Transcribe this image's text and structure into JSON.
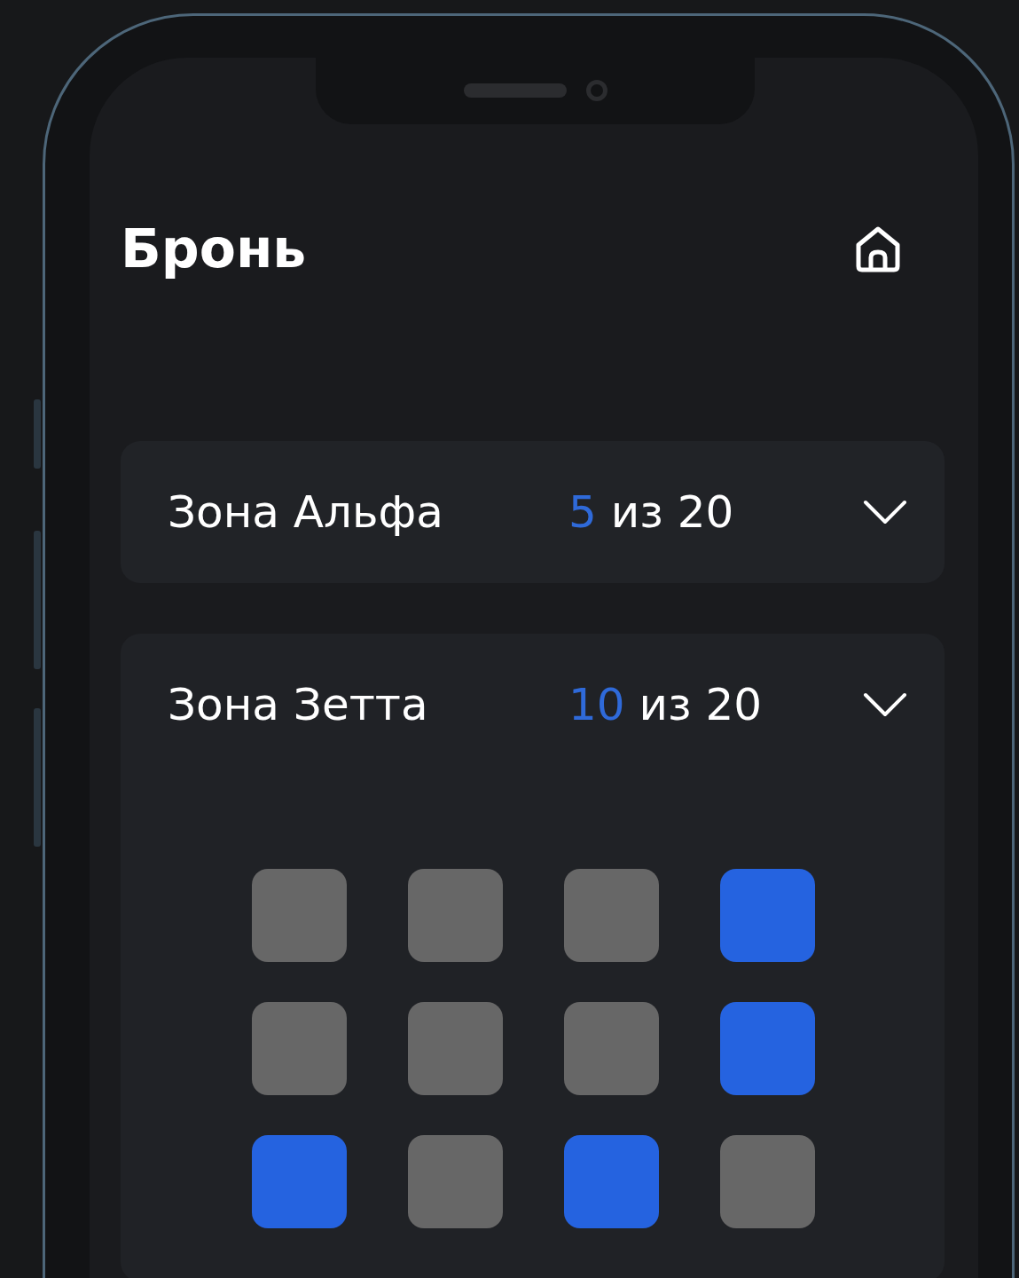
{
  "header": {
    "title": "Бронь"
  },
  "zones": [
    {
      "name": "Зона Альфа",
      "count": "5",
      "total": "из 20",
      "expanded": false
    },
    {
      "name": "Зона Зетта",
      "count": "10",
      "total": "из 20",
      "expanded": true,
      "seats": [
        {
          "selected": false
        },
        {
          "selected": false
        },
        {
          "selected": false
        },
        {
          "selected": true
        },
        {
          "selected": false
        },
        {
          "selected": false
        },
        {
          "selected": false
        },
        {
          "selected": true
        },
        {
          "selected": true
        },
        {
          "selected": false
        },
        {
          "selected": true
        },
        {
          "selected": false
        }
      ]
    }
  ]
}
